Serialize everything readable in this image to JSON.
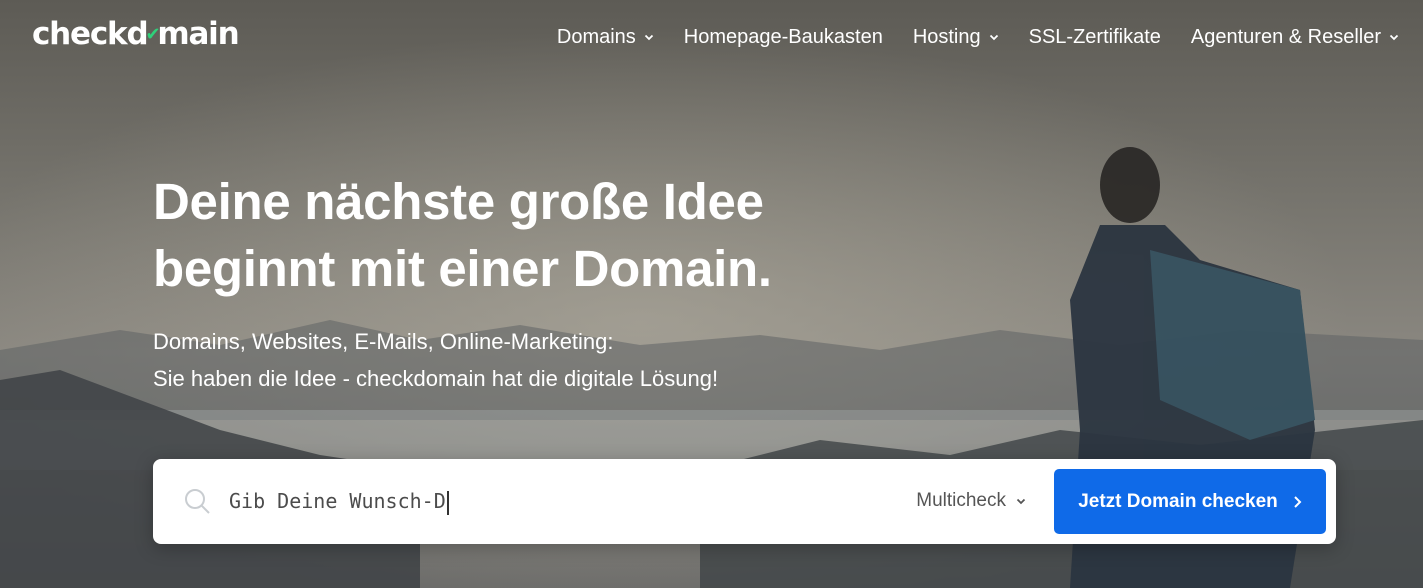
{
  "brand": {
    "logo_part1": "checkd",
    "logo_check": "✔",
    "logo_part2": "main",
    "accent_check_color": "#2fd07a"
  },
  "nav": {
    "items": [
      {
        "label": "Domains",
        "has_dropdown": true
      },
      {
        "label": "Homepage-Baukasten",
        "has_dropdown": false
      },
      {
        "label": "Hosting",
        "has_dropdown": true
      },
      {
        "label": "SSL-Zertifikate",
        "has_dropdown": false
      },
      {
        "label": "Agenturen & Reseller",
        "has_dropdown": true
      }
    ]
  },
  "hero": {
    "headline_line1": "Deine nächste große Idee",
    "headline_line2": "beginnt mit einer Domain.",
    "sub_line1": "Domains, Websites, E-Mails, Online-Marketing:",
    "sub_line2": "Sie haben die Idee - checkdomain hat die digitale Lösung!"
  },
  "search": {
    "typed_value": "Gib Deine Wunsch-D",
    "icon": "search-icon",
    "mode_label": "Multicheck",
    "cta_label": "Jetzt Domain checken",
    "cta_color": "#0f6ae8"
  }
}
